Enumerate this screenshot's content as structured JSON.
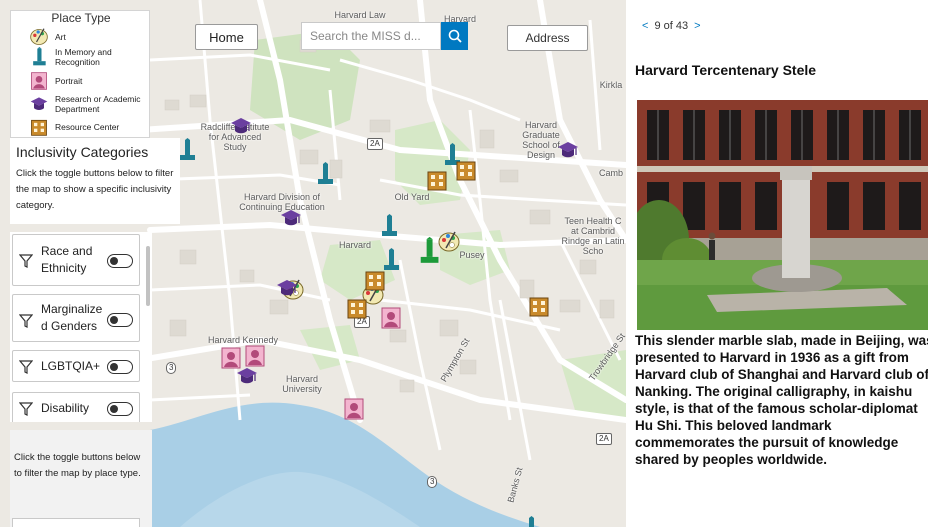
{
  "legend": {
    "title": "Place Type",
    "items": [
      {
        "label": "Art",
        "icon": "palette-icon"
      },
      {
        "label": "In Memory and Recognition",
        "icon": "monument-icon"
      },
      {
        "label": "Portrait",
        "icon": "portrait-icon"
      },
      {
        "label": "Research or Academic Department",
        "icon": "graduation-cap-icon"
      },
      {
        "label": "Resource Center",
        "icon": "building-icon"
      }
    ]
  },
  "inclusivity": {
    "title": "Inclusivity Categories",
    "description": "Click the toggle buttons below to filter the map to show a specific inclusivity category."
  },
  "filters": [
    {
      "label": "Race and Ethnicity",
      "icon": "filter-icon",
      "state": "off"
    },
    {
      "label": "Marginalized Genders",
      "icon": "filter-icon",
      "state": "off"
    },
    {
      "label": "LGBTQIA+",
      "icon": "filter-icon",
      "state": "off"
    },
    {
      "label": "Disability",
      "icon": "filter-icon",
      "state": "off"
    }
  ],
  "place_filter": {
    "description": "Click the toggle buttons below to filter the map by place type."
  },
  "toolbar": {
    "home_label": "Home",
    "search_placeholder": "Search the MISS d...",
    "address_label": "Address"
  },
  "map_labels": {
    "radcliffe": "Radcliffe Institute for Advanced Study",
    "division": "Harvard Division of Continuing Education",
    "old_yard": "Old Yard",
    "harvard_station": "Harvard",
    "pusey": "Pusey",
    "gsd": "Harvard Graduate School of Design",
    "teen_health": "Teen Health C at Cambrid Rindge an Latin Scho",
    "kennedy": "Harvard Kennedy",
    "harvard_university": "Harvard University",
    "plympton": "Plympton St",
    "trowbridge": "Trowbridge St",
    "banks": "Banks St",
    "kirkland": "Kirkla",
    "cambridge": "Camb",
    "law": "Harvard Law",
    "harvard_top": "Harvard",
    "route_2a": "2A",
    "route_3": "3"
  },
  "feature": {
    "pager": {
      "prev": "<",
      "position": "9 of 43",
      "next": ">"
    },
    "title": "Harvard Tercentenary Stele",
    "description": "This slender marble slab, made in Beijing, was presented to Harvard in 1936 as a gift from Harvard club of Shanghai and Harvard club of Nanking. The original calligraphy, in kaishu style, is that of the famous scholar-diplomat Hu Shi. This beloved landmark commemorates the pursuit of knowledge shared by peoples worldwide."
  },
  "colors": {
    "accent": "#0079c1",
    "map_land": "#ece9e3",
    "park_green": "#cfe3bf",
    "river": "#a9cfe6",
    "monument_teal": "#1f7f94",
    "portrait_pink": "#f3b5cf",
    "academic_purple": "#6b3fa0",
    "resource_orange": "#c98a2b"
  }
}
